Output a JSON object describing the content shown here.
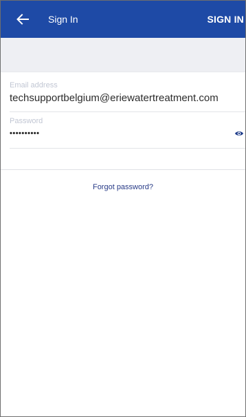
{
  "appbar": {
    "title": "Sign In",
    "action_label": "SIGN IN",
    "back_icon": "arrow-left-icon",
    "background_color": "#1e4aa6"
  },
  "form": {
    "email": {
      "label": "Email address",
      "value": "techsupportbelgium@eriewatertreatment.com"
    },
    "password": {
      "label": "Password",
      "value": "••••••••••",
      "toggle_icon": "eye-icon"
    }
  },
  "links": {
    "forgot_password": "Forgot password?"
  }
}
